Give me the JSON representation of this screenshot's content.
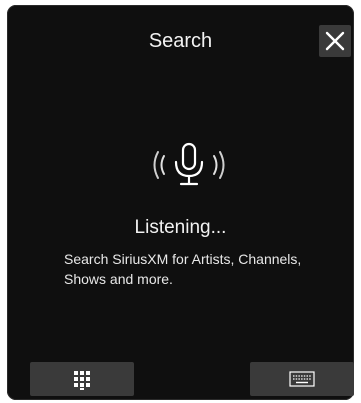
{
  "header": {
    "title": "Search",
    "close_icon": "close-icon"
  },
  "status": {
    "mic_icon": "microphone-listening-icon",
    "state_text": "Listening...",
    "description": "Search SiriusXM for Artists, Channels, Shows and more."
  },
  "footer": {
    "keypad_icon": "keypad-icon",
    "keyboard_icon": "keyboard-icon"
  },
  "colors": {
    "panel_bg": "#0f0f0f",
    "button_bg": "#3a3a3a",
    "text": "#f2f2f2"
  }
}
